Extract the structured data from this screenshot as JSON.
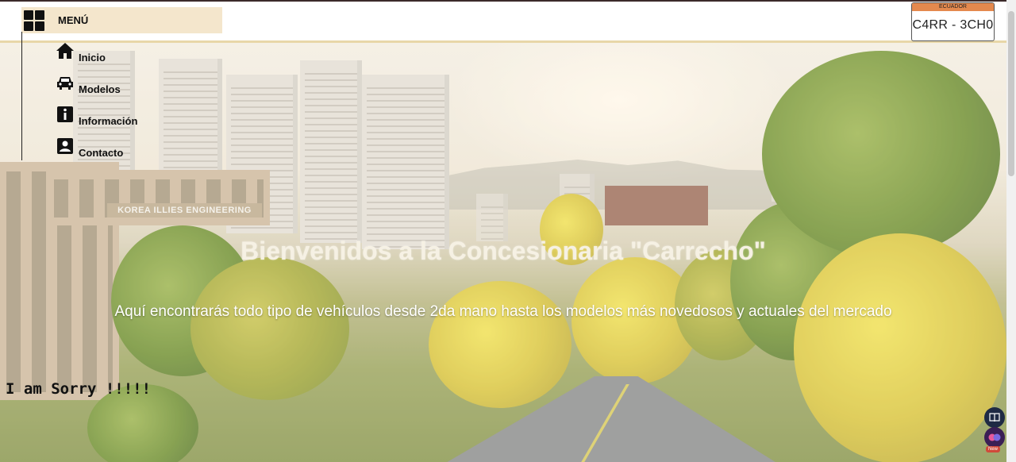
{
  "menu": {
    "title": "MENÚ",
    "items": [
      {
        "label": "Inicio",
        "icon": "home-icon"
      },
      {
        "label": "Modelos",
        "icon": "car-icon"
      },
      {
        "label": "Información",
        "icon": "info-icon"
      },
      {
        "label": "Contacto",
        "icon": "contact-card-icon"
      }
    ]
  },
  "plate": {
    "country": "ECUADOR",
    "number": "C4RR - 3CH0"
  },
  "hero": {
    "building_sign": "KOREA ILLIES ENGINEERING",
    "title": "Bienvenidos a la Concesionaria \"Carrecho\"",
    "subtitle": "Aquí encontrarás todo tipo de vehículos desde 2da mano hasta los modelos más novedosos y actuales del mercado"
  },
  "footer_note": "I am Sorry !!!!!",
  "floating": {
    "new_badge": "New"
  },
  "colors": {
    "menu_header_bg": "#f4e6cc",
    "plate_band": "#e4894e",
    "hero_title": "#f6f1e4"
  }
}
